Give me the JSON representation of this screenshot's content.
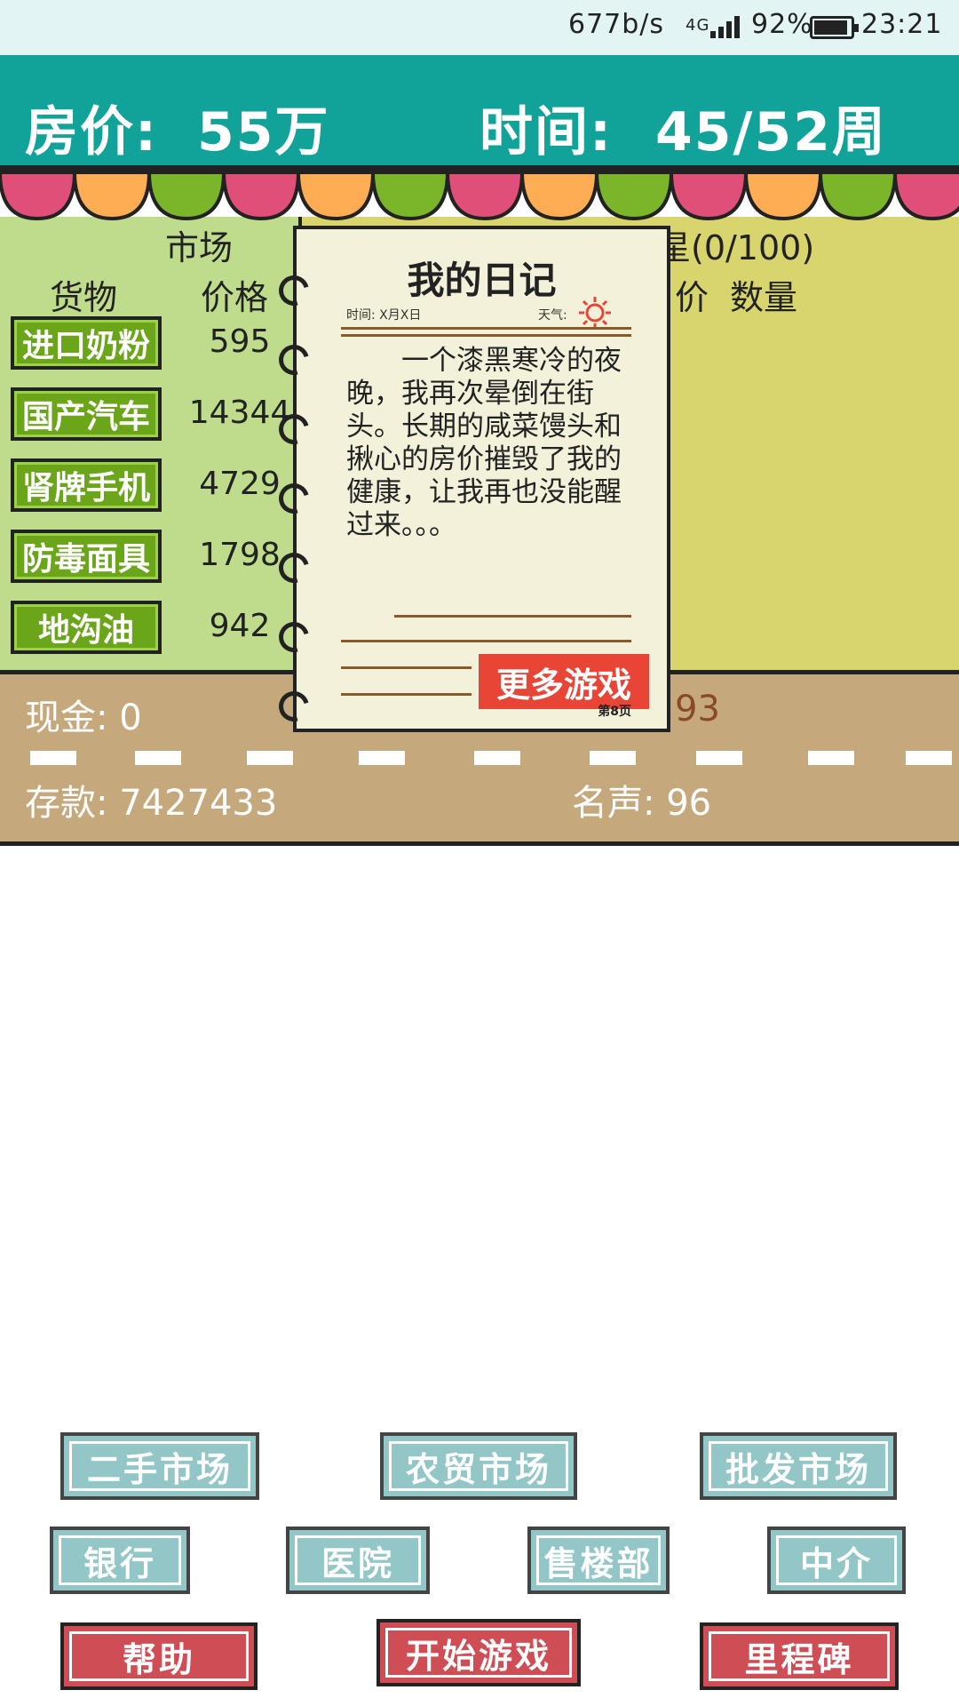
{
  "status_bar": {
    "net_speed": "677b/s",
    "network": "4G",
    "battery": "92%",
    "battery_level": 0.92,
    "time": "23:21"
  },
  "header": {
    "house_price_label": "房价:",
    "house_price": "55万",
    "time_label": "时间:",
    "week": "45/52周"
  },
  "market": {
    "title": "市场",
    "col_goods": "货物",
    "col_price": "价格",
    "items": [
      {
        "name": "进口奶粉",
        "price": "595"
      },
      {
        "name": "国产汽车",
        "price": "14344"
      },
      {
        "name": "肾牌手机",
        "price": "4729"
      },
      {
        "name": "防毒面具",
        "price": "1798"
      },
      {
        "name": "地沟油",
        "price": "942"
      }
    ]
  },
  "warehouse": {
    "title_partial": "星(0/100)",
    "col_price_partial": "价",
    "col_qty": "数量"
  },
  "stats": {
    "cash": "现金: 0",
    "debt_partial": "93",
    "deposit": "存款: 7427433",
    "fame": "名声: 96"
  },
  "diary": {
    "title": "我的日记",
    "date_label": "时间: X月X日",
    "weather_label": "天气:",
    "text": "一个漆黑寒冷的夜晚，我再次晕倒在街头。长期的咸菜馒头和揪心的房价摧毁了我的健康，让我再也没能醒过来。。。",
    "more_games": "更多游戏",
    "page": "第8页"
  },
  "nav": {
    "second_hand_market": "二手市场",
    "farmers_market": "农贸市场",
    "wholesale_market": "批发市场",
    "bank": "银行",
    "hospital": "医院",
    "sales_office": "售楼部",
    "agency": "中介",
    "help": "帮助",
    "start_game": "开始游戏",
    "milestones": "里程碑"
  },
  "colors": {
    "header": "#11a29a",
    "market_left": "#bfdc8c",
    "market_right": "#d8d56e",
    "road": "#c5a87c",
    "goods_button": "#6aa51a",
    "teal_button": "#93c6c6",
    "red_button": "#cf4d55",
    "more_games_button": "#e84537"
  }
}
